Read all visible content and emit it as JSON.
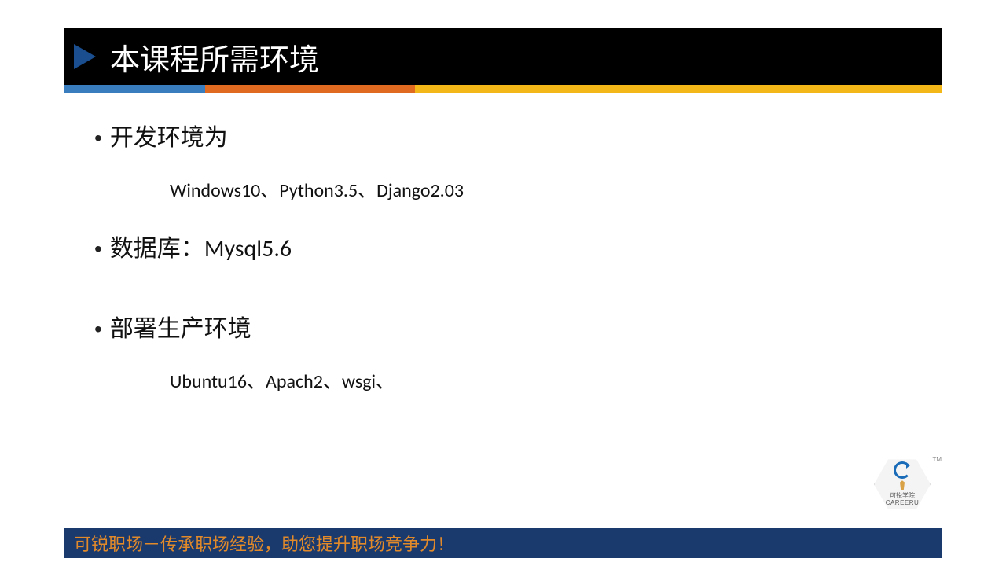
{
  "header": {
    "title": "本课程所需环境"
  },
  "content": {
    "items": [
      {
        "bullet": "开发环境为",
        "sub": "Windows10、Python3.5、Django2.03"
      },
      {
        "bullet_prefix": "数据库：",
        "bullet_latin": "Mysql5.6"
      },
      {
        "bullet": "部署生产环境",
        "sub": "Ubuntu16、Apach2、wsgi、"
      }
    ]
  },
  "footer": {
    "text": "可锐职场－传承职场经验，助您提升职场竞争力！"
  },
  "logo": {
    "name": "可锐学院",
    "sub": "CAREERU",
    "tm": "TM"
  }
}
